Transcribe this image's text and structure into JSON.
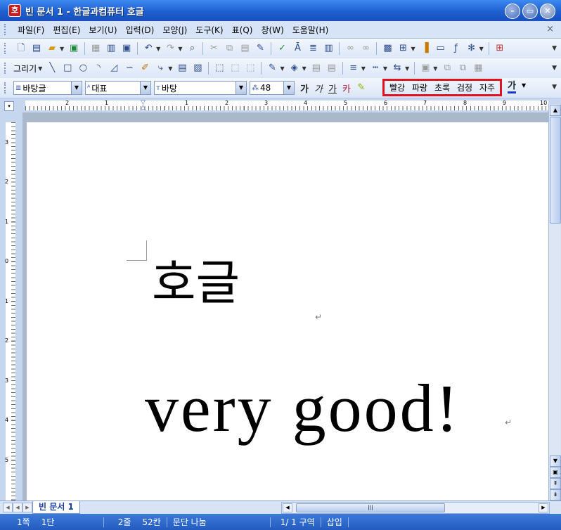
{
  "window": {
    "title": "빈 문서 1 - 한글과컴퓨터 호글",
    "app_icon": "호",
    "buttons": [
      "minimize-icon",
      "maximize-icon",
      "close-icon"
    ]
  },
  "menubar": {
    "items": [
      "파일(F)",
      "편집(E)",
      "보기(U)",
      "입력(D)",
      "모양(J)",
      "도구(K)",
      "표(Q)",
      "창(W)",
      "도움말(H)"
    ],
    "close": "×"
  },
  "drawing_toolbar": {
    "label": "그리기"
  },
  "format_toolbar": {
    "style": "바탕글",
    "language": "대표",
    "font": "바탕",
    "size": "48",
    "buttons": {
      "bold": "가",
      "italic": "가",
      "underline": "가",
      "strikethrough": "카"
    },
    "colors": [
      "빨강",
      "파랑",
      "초록",
      "검정",
      "자주"
    ],
    "text_color_label": "가",
    "highlight_color": "#e0121f"
  },
  "ruler": {
    "top_numbers": [
      "2",
      "1",
      "1",
      "2",
      "3",
      "4",
      "5",
      "6",
      "7",
      "8",
      "9",
      "10"
    ],
    "left_numbers": [
      "3",
      "2",
      "1",
      "0",
      "1",
      "2",
      "3",
      "4",
      "5"
    ]
  },
  "document": {
    "line1": "호글",
    "line2": "very  good!",
    "para_mark": "↵"
  },
  "tabs": {
    "active": "빈 문서 1"
  },
  "statusbar": {
    "page": "1쪽",
    "column": "1단",
    "line": "2줄",
    "char": "52칸",
    "para": "문단 나눔",
    "section": "1/  1 구역",
    "mode": "삽입"
  }
}
